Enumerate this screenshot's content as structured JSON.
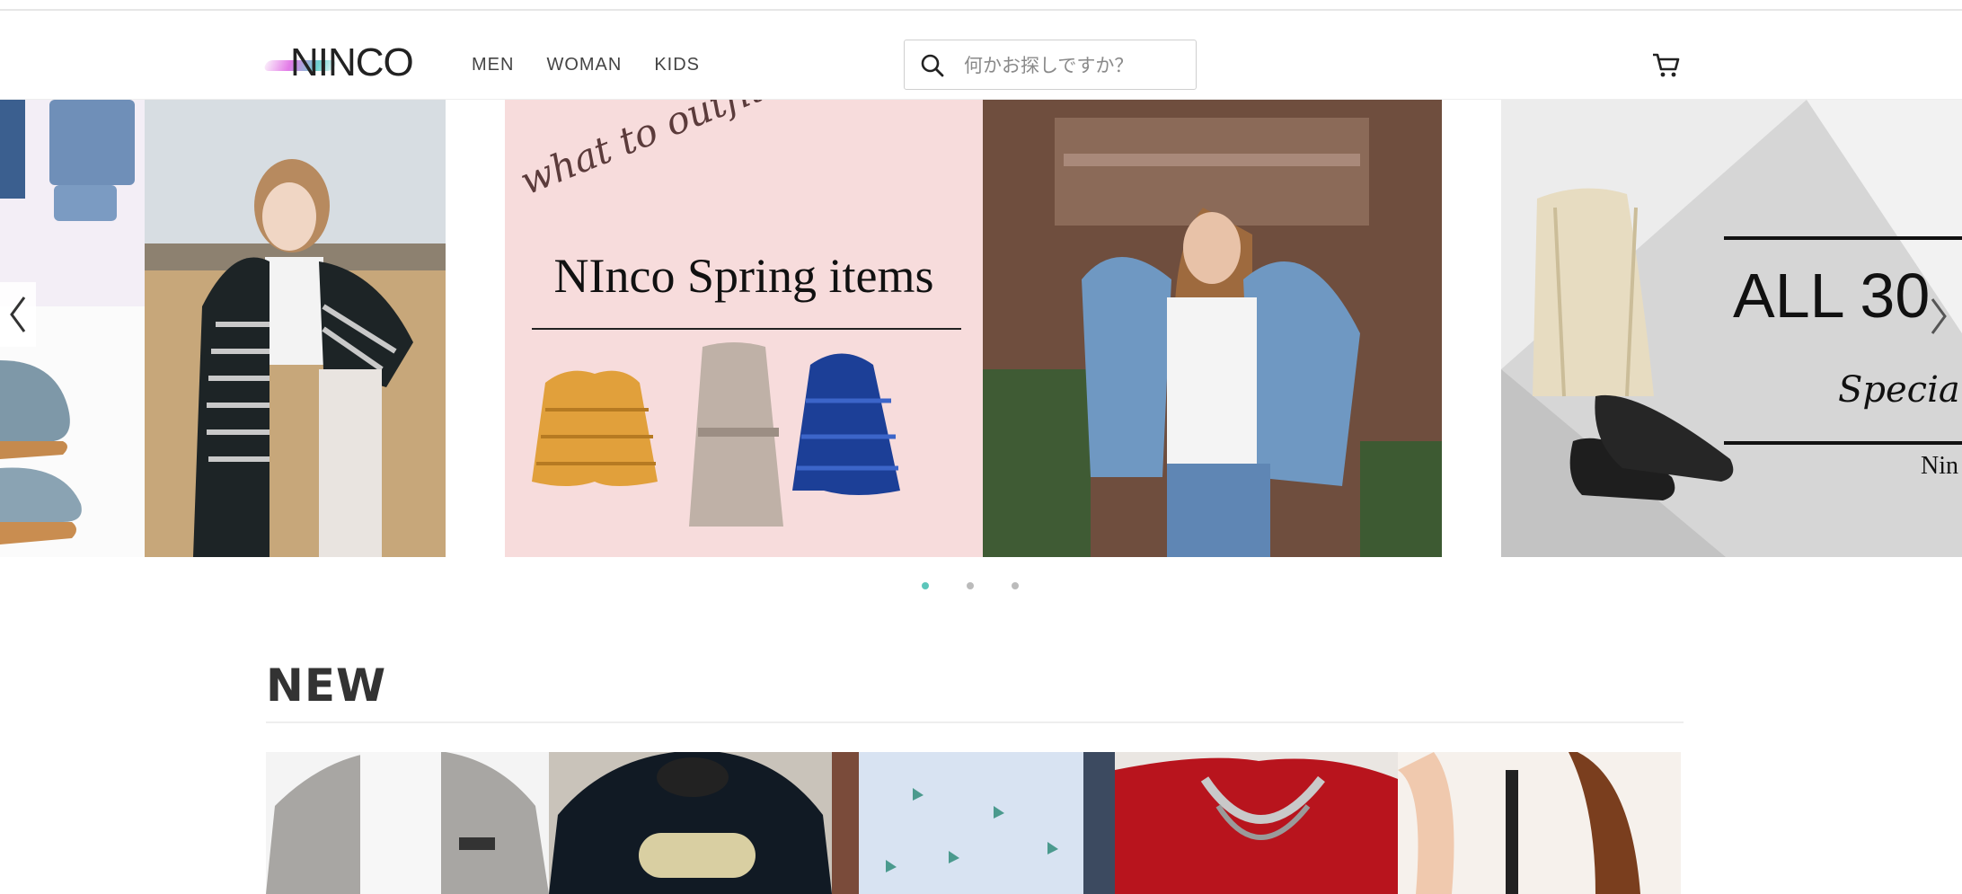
{
  "header": {
    "logo_text": "NINCO",
    "nav": [
      "MEN",
      "WOMAN",
      "KIDS"
    ],
    "search_placeholder": "何かお探しですか？"
  },
  "carousel": {
    "banner_script": "what to outfit",
    "banner_title": "NInco Spring items",
    "right_banner_text": "ALL 30",
    "right_banner_sub": "Specia",
    "right_banner_brand": "Nin",
    "slide_count": 3,
    "active_slide": 1
  },
  "new_section": {
    "title": "NEW"
  },
  "colors": {
    "accent": "#5cc6bb",
    "banner_pink": "#f7dcdc"
  }
}
